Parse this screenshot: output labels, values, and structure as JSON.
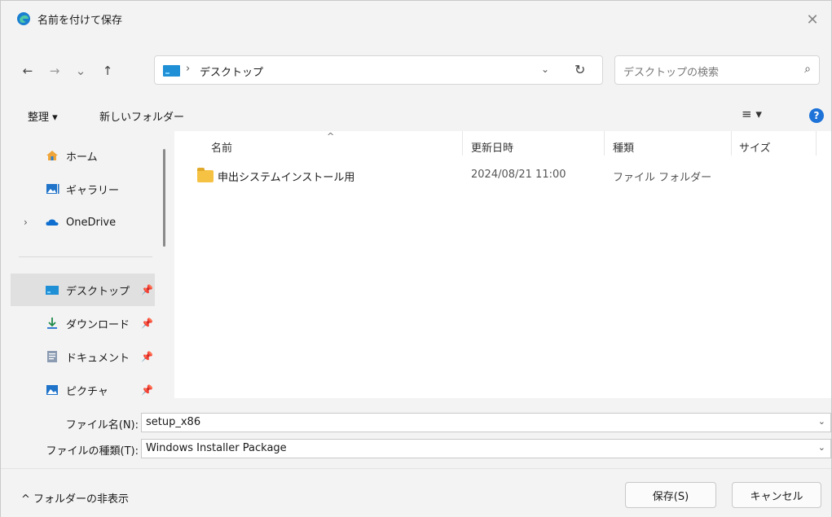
{
  "window": {
    "title": "名前を付けて保存",
    "close_glyph": "✕"
  },
  "nav": {
    "back": "←",
    "forward": "→",
    "recent": "⌄",
    "up": "↑",
    "address": {
      "path_segment": "デスクトップ",
      "separator": "›",
      "dropdown": "⌄",
      "refresh": "↻"
    },
    "search": {
      "placeholder": "デスクトップの検索",
      "icon": "⌕"
    }
  },
  "command_bar": {
    "organize": "整理 ▾",
    "new_folder": "新しいフォルダー",
    "view": "≡ ▾",
    "help": "?"
  },
  "navigation_pane": {
    "items": [
      {
        "label": "ホーム",
        "icon": "home-icon"
      },
      {
        "label": "ギャラリー",
        "icon": "gallery-icon"
      },
      {
        "label": "OneDrive",
        "icon": "cloud-icon",
        "expand": "›"
      },
      {
        "label": "デスクトップ",
        "icon": "desktop-icon",
        "pinned": "📌"
      },
      {
        "label": "ダウンロード",
        "icon": "download-icon",
        "pinned": "📌"
      },
      {
        "label": "ドキュメント",
        "icon": "document-icon",
        "pinned": "📌"
      },
      {
        "label": "ピクチャ",
        "icon": "pictures-icon",
        "pinned": "📌"
      }
    ],
    "selected_index": 3
  },
  "file_list": {
    "columns": [
      "名前",
      "更新日時",
      "種類",
      "サイズ"
    ],
    "sort_glyph": "^",
    "rows": [
      {
        "name": "申出システムインストール用",
        "modified": "2024/08/21 11:00",
        "type": "ファイル フォルダー",
        "size": ""
      }
    ]
  },
  "fields": {
    "filename": {
      "label": "ファイル名(N):",
      "value": "setup_x86",
      "dropdown": "⌄"
    },
    "filetype": {
      "label": "ファイルの種類(T):",
      "value": "Windows Installer Package",
      "dropdown": "⌄"
    }
  },
  "footer": {
    "toggle_folders": "^ フォルダーの非表示",
    "save": "保存(S)",
    "cancel": "キャンセル"
  },
  "colors": {
    "accent": "#1e73d8",
    "folder": "#f6c243",
    "selection": "#e0e0e0"
  }
}
